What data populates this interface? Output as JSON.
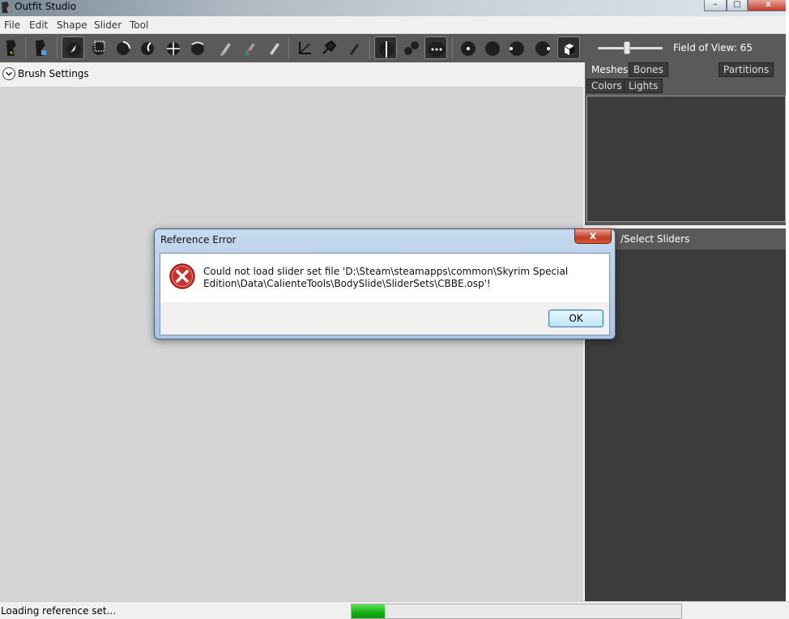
{
  "window": {
    "title": "Outfit Studio"
  },
  "menu": [
    "File",
    "Edit",
    "Shape",
    "Slider",
    "Tool"
  ],
  "toolbar": {
    "fov_label": "Field of View: 65",
    "fov_value": 65
  },
  "tabs": {
    "meshes": "Meshes",
    "bones": "Bones",
    "partitions": "Partitions",
    "colors": "Colors",
    "lights": "Lights"
  },
  "brush": {
    "label": "Brush Settings"
  },
  "sliders": {
    "label": "/Select Sliders"
  },
  "status": {
    "text": "Loading reference set...",
    "progress_percent": 10
  },
  "dialog": {
    "title": "Reference Error",
    "message": "Could not load slider set file 'D:\\Steam\\steamapps\\common\\Skyrim Special Edition\\Data\\CalienteTools\\BodySlide\\SliderSets\\CBBE.osp'!",
    "ok_label": "OK",
    "close_glyph": "x"
  },
  "window_controls": {
    "minimize": "–",
    "maximize": "□",
    "close": "x"
  },
  "colors": {
    "toolbar_bg": "#5a5a5a",
    "panel_bg": "#3c3c3c",
    "canvas_bg": "#d4d4d4",
    "progress": "#17b417"
  }
}
